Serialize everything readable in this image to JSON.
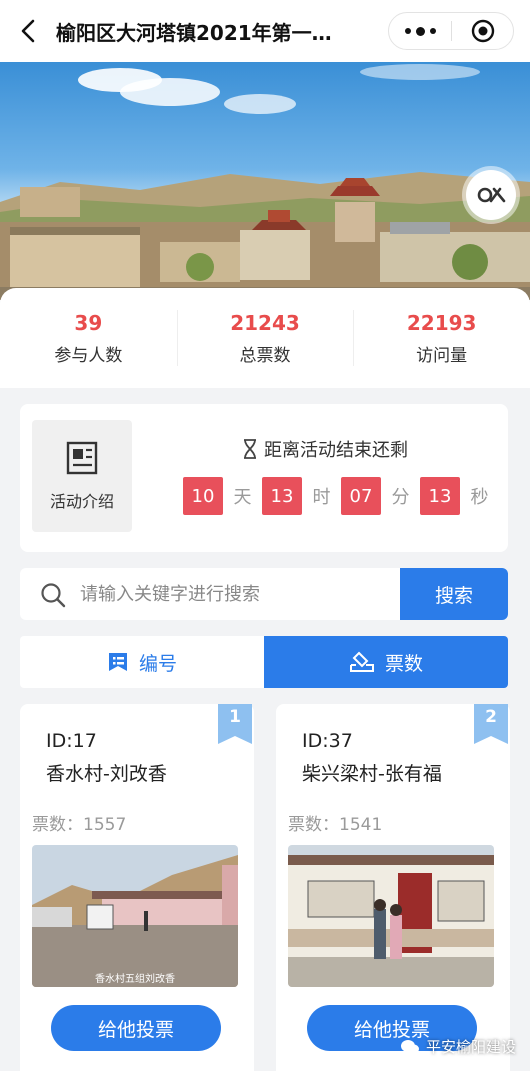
{
  "header": {
    "title": "榆阳区大河塔镇2021年第一…"
  },
  "stats": [
    {
      "value": "39",
      "label": "参与人数"
    },
    {
      "value": "21243",
      "label": "总票数"
    },
    {
      "value": "22193",
      "label": "访问量"
    }
  ],
  "activity": {
    "intro_label": "活动介绍",
    "countdown_heading": "距离活动结束还剩",
    "countdown": [
      {
        "value": "10",
        "unit": "天"
      },
      {
        "value": "13",
        "unit": "时"
      },
      {
        "value": "07",
        "unit": "分"
      },
      {
        "value": "13",
        "unit": "秒"
      }
    ]
  },
  "search": {
    "placeholder": "请输入关键字进行搜索",
    "button_label": "搜索"
  },
  "sort_tabs": [
    {
      "label": "编号",
      "icon": "list-icon",
      "active": false
    },
    {
      "label": "票数",
      "icon": "ballot-icon",
      "active": true
    }
  ],
  "candidates": [
    {
      "rank": "1",
      "id": "ID:17",
      "name": "香水村-刘改香",
      "votes": "票数：1557",
      "photo_caption": "香水村五组刘改香",
      "vote_button": "给他投票"
    },
    {
      "rank": "2",
      "id": "ID:37",
      "name": "柴兴梁村-张有福",
      "votes": "票数：1541",
      "vote_button": "给他投票"
    }
  ],
  "watermark": "平安榆阳建设",
  "colors": {
    "accent": "#2b7ce9",
    "highlight_red": "#e84c4c",
    "rank_badge": "#8ec0f0"
  }
}
